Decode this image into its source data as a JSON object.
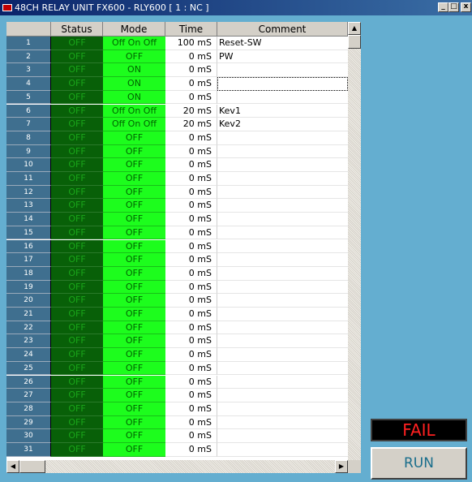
{
  "window": {
    "title": "48CH RELAY UNIT FX600 - RLY600 [ 1 : NC ]",
    "minimize_glyph": "_",
    "maximize_glyph": "□",
    "close_glyph": "x"
  },
  "grid": {
    "columns": [
      "",
      "Status",
      "Mode",
      "Time",
      "Comment"
    ],
    "rows": [
      {
        "num": "1",
        "status": "OFF",
        "mode": "Off On Off",
        "time": "100 mS",
        "comment": "Reset-SW"
      },
      {
        "num": "2",
        "status": "OFF",
        "mode": "OFF",
        "time": "0 mS",
        "comment": "PW"
      },
      {
        "num": "3",
        "status": "OFF",
        "mode": "ON",
        "time": "0 mS",
        "comment": ""
      },
      {
        "num": "4",
        "status": "OFF",
        "mode": "ON",
        "time": "0 mS",
        "comment": ""
      },
      {
        "num": "5",
        "status": "OFF",
        "mode": "ON",
        "time": "0 mS",
        "comment": ""
      },
      {
        "num": "6",
        "status": "OFF",
        "mode": "Off On Off",
        "time": "20 mS",
        "comment": "Kev1"
      },
      {
        "num": "7",
        "status": "OFF",
        "mode": "Off On Off",
        "time": "20 mS",
        "comment": "Kev2"
      },
      {
        "num": "8",
        "status": "OFF",
        "mode": "OFF",
        "time": "0 mS",
        "comment": ""
      },
      {
        "num": "9",
        "status": "OFF",
        "mode": "OFF",
        "time": "0 mS",
        "comment": ""
      },
      {
        "num": "10",
        "status": "OFF",
        "mode": "OFF",
        "time": "0 mS",
        "comment": ""
      },
      {
        "num": "11",
        "status": "OFF",
        "mode": "OFF",
        "time": "0 mS",
        "comment": ""
      },
      {
        "num": "12",
        "status": "OFF",
        "mode": "OFF",
        "time": "0 mS",
        "comment": ""
      },
      {
        "num": "13",
        "status": "OFF",
        "mode": "OFF",
        "time": "0 mS",
        "comment": ""
      },
      {
        "num": "14",
        "status": "OFF",
        "mode": "OFF",
        "time": "0 mS",
        "comment": ""
      },
      {
        "num": "15",
        "status": "OFF",
        "mode": "OFF",
        "time": "0 mS",
        "comment": ""
      },
      {
        "num": "16",
        "status": "OFF",
        "mode": "OFF",
        "time": "0 mS",
        "comment": ""
      },
      {
        "num": "17",
        "status": "OFF",
        "mode": "OFF",
        "time": "0 mS",
        "comment": ""
      },
      {
        "num": "18",
        "status": "OFF",
        "mode": "OFF",
        "time": "0 mS",
        "comment": ""
      },
      {
        "num": "19",
        "status": "OFF",
        "mode": "OFF",
        "time": "0 mS",
        "comment": ""
      },
      {
        "num": "20",
        "status": "OFF",
        "mode": "OFF",
        "time": "0 mS",
        "comment": ""
      },
      {
        "num": "21",
        "status": "OFF",
        "mode": "OFF",
        "time": "0 mS",
        "comment": ""
      },
      {
        "num": "22",
        "status": "OFF",
        "mode": "OFF",
        "time": "0 mS",
        "comment": ""
      },
      {
        "num": "23",
        "status": "OFF",
        "mode": "OFF",
        "time": "0 mS",
        "comment": ""
      },
      {
        "num": "24",
        "status": "OFF",
        "mode": "OFF",
        "time": "0 mS",
        "comment": ""
      },
      {
        "num": "25",
        "status": "OFF",
        "mode": "OFF",
        "time": "0 mS",
        "comment": ""
      },
      {
        "num": "26",
        "status": "OFF",
        "mode": "OFF",
        "time": "0 mS",
        "comment": ""
      },
      {
        "num": "27",
        "status": "OFF",
        "mode": "OFF",
        "time": "0 mS",
        "comment": ""
      },
      {
        "num": "28",
        "status": "OFF",
        "mode": "OFF",
        "time": "0 mS",
        "comment": ""
      },
      {
        "num": "29",
        "status": "OFF",
        "mode": "OFF",
        "time": "0 mS",
        "comment": ""
      },
      {
        "num": "30",
        "status": "OFF",
        "mode": "OFF",
        "time": "0 mS",
        "comment": ""
      },
      {
        "num": "31",
        "status": "OFF",
        "mode": "OFF",
        "time": "0 mS",
        "comment": ""
      }
    ]
  },
  "scroll": {
    "up": "▲",
    "down": "▼",
    "left": "◀",
    "right": "▶"
  },
  "indicator": {
    "fail_label": "FAIL",
    "fail_color": "#ff2020"
  },
  "buttons": {
    "run_label": "RUN"
  },
  "colors": {
    "status_bg": "#086008",
    "mode_bg": "#1dfd1d",
    "rownum_bg": "#3f6f8f",
    "client_bg": "#64aed0"
  }
}
